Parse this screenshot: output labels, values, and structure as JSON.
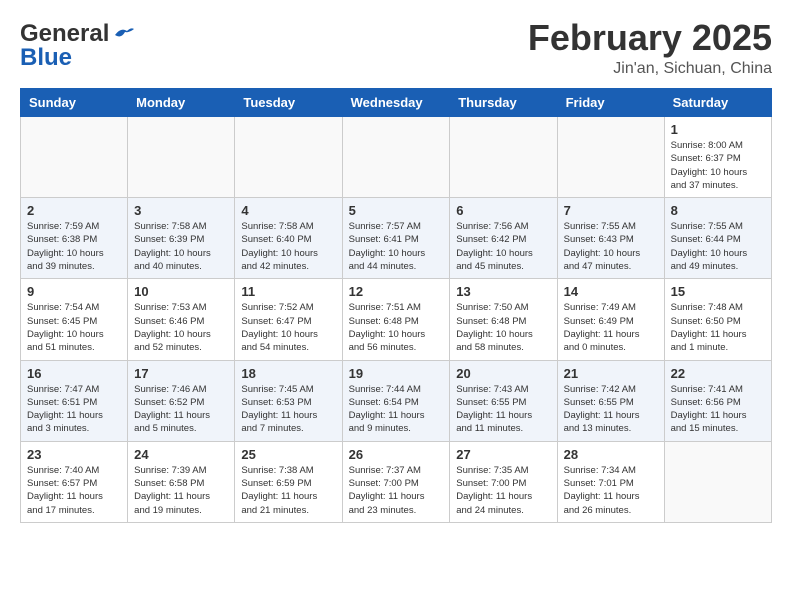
{
  "header": {
    "logo_general": "General",
    "logo_blue": "Blue",
    "month_title": "February 2025",
    "location": "Jin'an, Sichuan, China"
  },
  "weekdays": [
    "Sunday",
    "Monday",
    "Tuesday",
    "Wednesday",
    "Thursday",
    "Friday",
    "Saturday"
  ],
  "weeks": [
    [
      {
        "day": "",
        "info": ""
      },
      {
        "day": "",
        "info": ""
      },
      {
        "day": "",
        "info": ""
      },
      {
        "day": "",
        "info": ""
      },
      {
        "day": "",
        "info": ""
      },
      {
        "day": "",
        "info": ""
      },
      {
        "day": "1",
        "info": "Sunrise: 8:00 AM\nSunset: 6:37 PM\nDaylight: 10 hours\nand 37 minutes."
      }
    ],
    [
      {
        "day": "2",
        "info": "Sunrise: 7:59 AM\nSunset: 6:38 PM\nDaylight: 10 hours\nand 39 minutes."
      },
      {
        "day": "3",
        "info": "Sunrise: 7:58 AM\nSunset: 6:39 PM\nDaylight: 10 hours\nand 40 minutes."
      },
      {
        "day": "4",
        "info": "Sunrise: 7:58 AM\nSunset: 6:40 PM\nDaylight: 10 hours\nand 42 minutes."
      },
      {
        "day": "5",
        "info": "Sunrise: 7:57 AM\nSunset: 6:41 PM\nDaylight: 10 hours\nand 44 minutes."
      },
      {
        "day": "6",
        "info": "Sunrise: 7:56 AM\nSunset: 6:42 PM\nDaylight: 10 hours\nand 45 minutes."
      },
      {
        "day": "7",
        "info": "Sunrise: 7:55 AM\nSunset: 6:43 PM\nDaylight: 10 hours\nand 47 minutes."
      },
      {
        "day": "8",
        "info": "Sunrise: 7:55 AM\nSunset: 6:44 PM\nDaylight: 10 hours\nand 49 minutes."
      }
    ],
    [
      {
        "day": "9",
        "info": "Sunrise: 7:54 AM\nSunset: 6:45 PM\nDaylight: 10 hours\nand 51 minutes."
      },
      {
        "day": "10",
        "info": "Sunrise: 7:53 AM\nSunset: 6:46 PM\nDaylight: 10 hours\nand 52 minutes."
      },
      {
        "day": "11",
        "info": "Sunrise: 7:52 AM\nSunset: 6:47 PM\nDaylight: 10 hours\nand 54 minutes."
      },
      {
        "day": "12",
        "info": "Sunrise: 7:51 AM\nSunset: 6:48 PM\nDaylight: 10 hours\nand 56 minutes."
      },
      {
        "day": "13",
        "info": "Sunrise: 7:50 AM\nSunset: 6:48 PM\nDaylight: 10 hours\nand 58 minutes."
      },
      {
        "day": "14",
        "info": "Sunrise: 7:49 AM\nSunset: 6:49 PM\nDaylight: 11 hours\nand 0 minutes."
      },
      {
        "day": "15",
        "info": "Sunrise: 7:48 AM\nSunset: 6:50 PM\nDaylight: 11 hours\nand 1 minute."
      }
    ],
    [
      {
        "day": "16",
        "info": "Sunrise: 7:47 AM\nSunset: 6:51 PM\nDaylight: 11 hours\nand 3 minutes."
      },
      {
        "day": "17",
        "info": "Sunrise: 7:46 AM\nSunset: 6:52 PM\nDaylight: 11 hours\nand 5 minutes."
      },
      {
        "day": "18",
        "info": "Sunrise: 7:45 AM\nSunset: 6:53 PM\nDaylight: 11 hours\nand 7 minutes."
      },
      {
        "day": "19",
        "info": "Sunrise: 7:44 AM\nSunset: 6:54 PM\nDaylight: 11 hours\nand 9 minutes."
      },
      {
        "day": "20",
        "info": "Sunrise: 7:43 AM\nSunset: 6:55 PM\nDaylight: 11 hours\nand 11 minutes."
      },
      {
        "day": "21",
        "info": "Sunrise: 7:42 AM\nSunset: 6:55 PM\nDaylight: 11 hours\nand 13 minutes."
      },
      {
        "day": "22",
        "info": "Sunrise: 7:41 AM\nSunset: 6:56 PM\nDaylight: 11 hours\nand 15 minutes."
      }
    ],
    [
      {
        "day": "23",
        "info": "Sunrise: 7:40 AM\nSunset: 6:57 PM\nDaylight: 11 hours\nand 17 minutes."
      },
      {
        "day": "24",
        "info": "Sunrise: 7:39 AM\nSunset: 6:58 PM\nDaylight: 11 hours\nand 19 minutes."
      },
      {
        "day": "25",
        "info": "Sunrise: 7:38 AM\nSunset: 6:59 PM\nDaylight: 11 hours\nand 21 minutes."
      },
      {
        "day": "26",
        "info": "Sunrise: 7:37 AM\nSunset: 7:00 PM\nDaylight: 11 hours\nand 23 minutes."
      },
      {
        "day": "27",
        "info": "Sunrise: 7:35 AM\nSunset: 7:00 PM\nDaylight: 11 hours\nand 24 minutes."
      },
      {
        "day": "28",
        "info": "Sunrise: 7:34 AM\nSunset: 7:01 PM\nDaylight: 11 hours\nand 26 minutes."
      },
      {
        "day": "",
        "info": ""
      }
    ]
  ]
}
